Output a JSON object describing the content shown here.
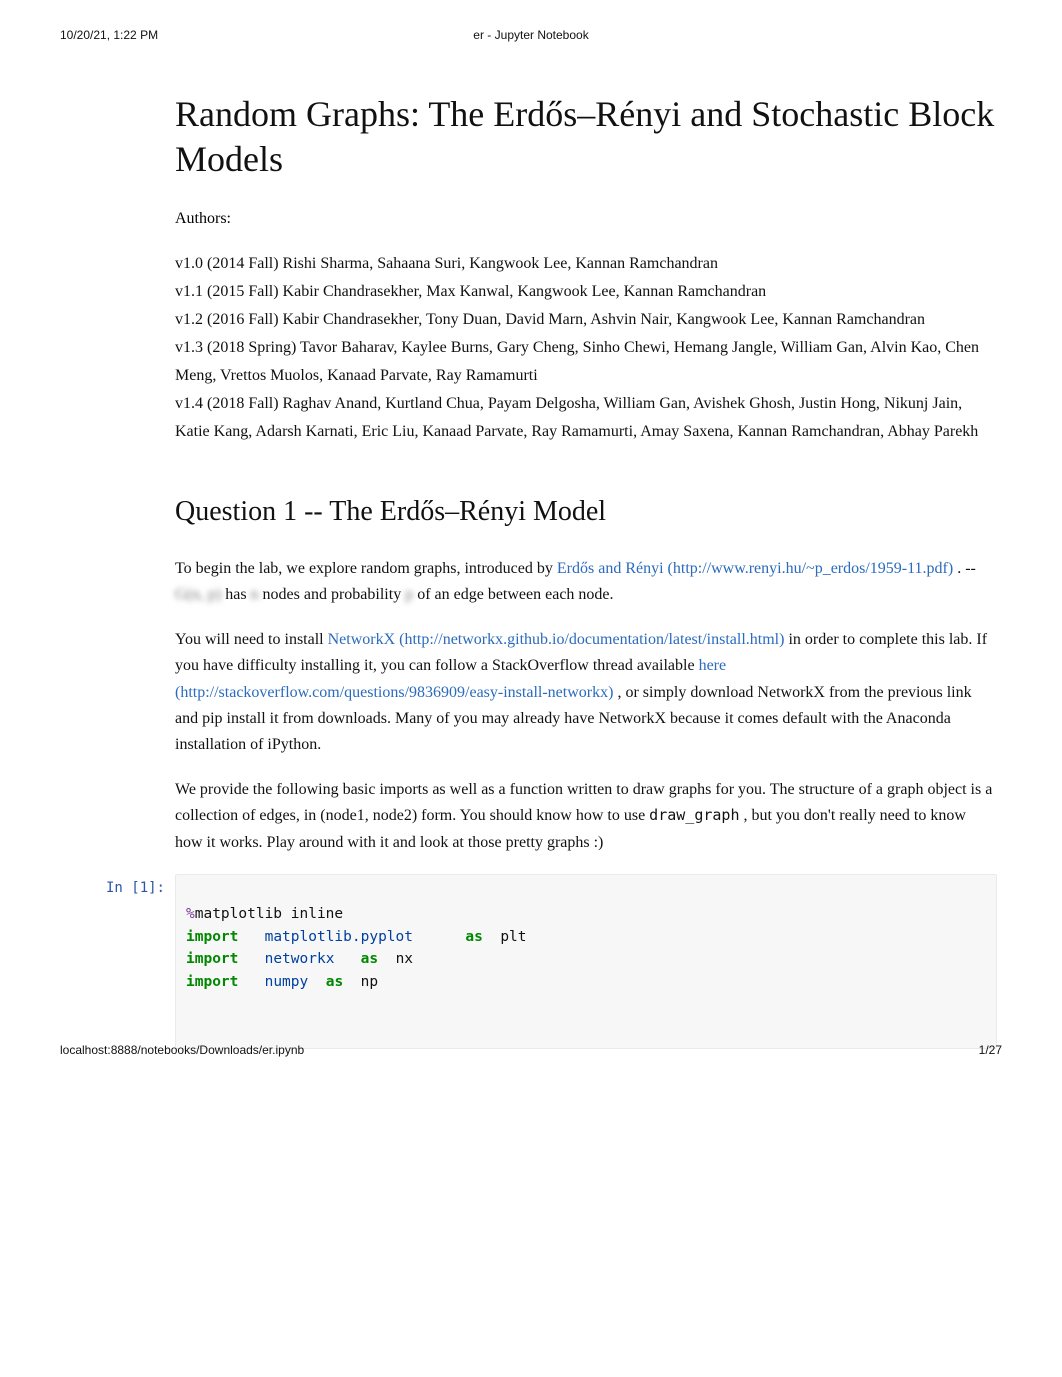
{
  "header": {
    "timestamp": "10/20/21, 1:22 PM",
    "title_center": "er - Jupyter Notebook"
  },
  "doc": {
    "title": "Random Graphs: The Erdős–Rényi and Stochastic Block Models",
    "authors_label": "Authors:",
    "versions_text": "v1.0 (2014 Fall) Rishi Sharma, Sahaana Suri, Kangwook Lee, Kannan Ramchandran\nv1.1 (2015 Fall) Kabir Chandrasekher, Max Kanwal, Kangwook Lee, Kannan Ramchandran\nv1.2 (2016 Fall) Kabir Chandrasekher, Tony Duan, David Marn, Ashvin Nair, Kangwook Lee, Kannan Ramchandran\nv1.3 (2018 Spring) Tavor Baharav, Kaylee Burns, Gary Cheng, Sinho Chewi, Hemang Jangle, William Gan, Alvin Kao, Chen Meng, Vrettos Muolos, Kanaad Parvate, Ray Ramamurti\nv1.4 (2018 Fall) Raghav Anand, Kurtland Chua, Payam Delgosha, William Gan, Avishek Ghosh, Justin Hong, Nikunj Jain, Katie Kang, Adarsh Karnati, Eric Liu, Kanaad Parvate, Ray Ramamurti, Amay Saxena, Kannan Ramchandran, Abhay Parekh"
  },
  "q1": {
    "heading": "Question 1 -- The Erdős–Rényi Model",
    "p1_a": "To begin the lab, we explore random graphs, introduced by ",
    "link1_text": "Erdős and Rényi (http://www.renyi.hu/~p_erdos/1959-11.pdf)",
    "p1_b": " . -- ",
    "blur1": "G(n, p)",
    "p1_c": " has ",
    "blur2": "n",
    "p1_d": " nodes and probability ",
    "blur3": "p",
    "p1_e": " of an edge between each node.",
    "p2_a": "You will need to install ",
    "link2_text": "NetworkX (http://networkx.github.io/documentation/latest/install.html)",
    "p2_b": " in order to complete this lab. If you have difficulty installing it, you can follow a StackOverflow thread available ",
    "link3_text": "here (http://stackoverflow.com/questions/9836909/easy-install-networkx)",
    "p2_c": " , or simply download NetworkX from the previous link and pip install it from downloads. Many of you may already have NetworkX because it comes default with the Anaconda installation of iPython.",
    "p3_a": "We provide the following basic imports as well as a function written to draw graphs for you. The structure of a graph object is a collection of edges, in (node1, node2) form. You should know how to use ",
    "code_inline": "draw_graph",
    "p3_b": " , but you don't really need to know how it works. Play around with it and look at those pretty graphs :)"
  },
  "code": {
    "prompt": "In [1]:",
    "l1_a": "%",
    "l1_b": "matplotlib inline",
    "kw_import": "import",
    "kw_as": "as",
    "l2_mod": "matplotlib.pyplot",
    "l2_alias": "plt",
    "l3_mod": "networkx",
    "l3_alias": "nx",
    "l4_mod": "numpy",
    "l4_alias": "np"
  },
  "footer": {
    "url": "localhost:8888/notebooks/Downloads/er.ipynb",
    "page_num": "1/27"
  }
}
